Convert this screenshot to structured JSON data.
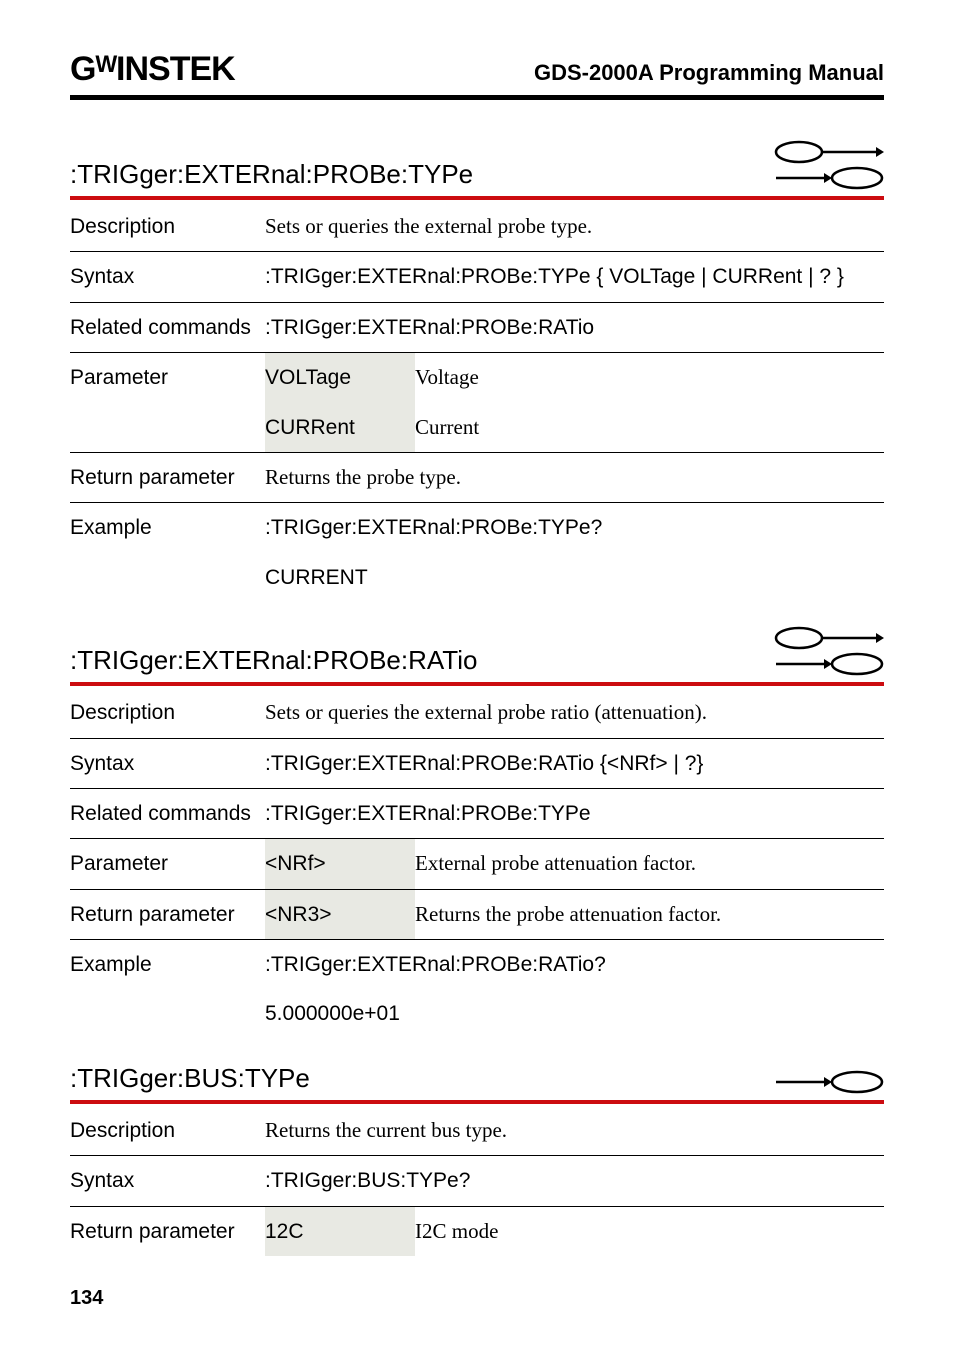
{
  "header": {
    "logo": "GᵂINSTEK",
    "manual_title": "GDS-2000A Programming Manual"
  },
  "sections": [
    {
      "heading": ":TRIGger:EXTERnal:PROBe:TYPe",
      "icons": [
        "query",
        "set"
      ],
      "rows": [
        {
          "cells": [
            "Description",
            "Sets or queries the external probe type."
          ],
          "col2_serif": true
        },
        {
          "cells": [
            "Syntax",
            ":TRIGger:EXTERnal:PROBe:TYPe { VOLTage | CURRent | ? }"
          ]
        },
        {
          "cells": [
            "Related commands",
            ":TRIGger:EXTERnal:PROBe:RATio"
          ]
        },
        {
          "cells3": [
            "Parameter",
            "VOLTage",
            "Voltage"
          ],
          "shaded": true
        },
        {
          "cells3": [
            "",
            "CURRent",
            "Current"
          ],
          "shaded": true,
          "no_top": true
        },
        {
          "cells": [
            "Return parameter",
            "Returns the probe type."
          ],
          "col2_serif": true
        },
        {
          "cells": [
            "Example",
            ":TRIGger:EXTERnal:PROBe:TYPe?"
          ]
        },
        {
          "cells": [
            "",
            "CURRENT"
          ],
          "no_top": true,
          "no_border": true
        }
      ]
    },
    {
      "heading": ":TRIGger:EXTERnal:PROBe:RATio",
      "icons": [
        "query",
        "set"
      ],
      "rows": [
        {
          "cells": [
            "Description",
            "Sets or queries the external probe ratio (attenuation)."
          ],
          "col2_serif": true
        },
        {
          "cells": [
            "Syntax",
            ":TRIGger:EXTERnal:PROBe:RATio {<NRf> | ?}"
          ]
        },
        {
          "cells": [
            "Related commands",
            ":TRIGger:EXTERnal:PROBe:TYPe"
          ]
        },
        {
          "cells3": [
            "Parameter",
            "<NRf>",
            "External probe attenuation factor."
          ],
          "shaded": true
        },
        {
          "cells3": [
            "Return parameter",
            "<NR3>",
            "Returns the probe attenuation factor."
          ],
          "shaded": true
        },
        {
          "cells": [
            "Example",
            ":TRIGger:EXTERnal:PROBe:RATio?"
          ]
        },
        {
          "cells": [
            "",
            "5.000000e+01"
          ],
          "no_top": true,
          "no_border": true
        }
      ]
    },
    {
      "heading": ":TRIGger:BUS:TYPe",
      "icons": [
        "set"
      ],
      "rows": [
        {
          "cells": [
            "Description",
            "Returns the current bus type."
          ],
          "col2_serif": true
        },
        {
          "cells": [
            "Syntax",
            ":TRIGger:BUS:TYPe?"
          ]
        },
        {
          "cells3": [
            "Return parameter",
            "12C",
            "I2C mode"
          ],
          "shaded": true,
          "no_border": true
        }
      ]
    }
  ],
  "page_number": "134",
  "chart_data": null
}
